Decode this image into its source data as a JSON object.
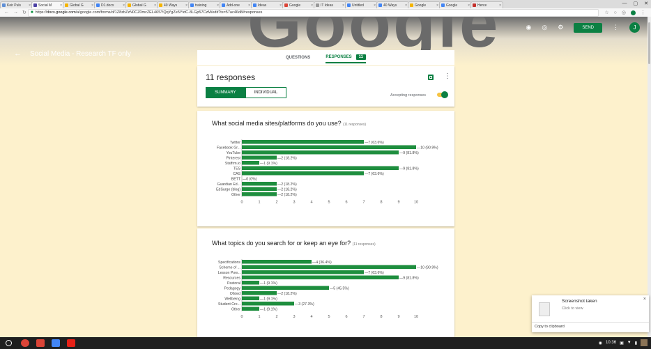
{
  "browser": {
    "tabs": [
      {
        "label": "Keir Puls",
        "color": "#5f8fd6"
      },
      {
        "label": "Social M",
        "color": "#4b3fa3",
        "active": true
      },
      {
        "label": "Global G",
        "color": "#f4b400"
      },
      {
        "label": "D1.docx",
        "color": "#4285f4"
      },
      {
        "label": "Global G",
        "color": "#f4b400"
      },
      {
        "label": "40 Ways",
        "color": "#f4b400"
      },
      {
        "label": "training",
        "color": "#4285f4"
      },
      {
        "label": "Add-one",
        "color": "#4285f4"
      },
      {
        "label": "Ideas",
        "color": "#4285f4"
      },
      {
        "label": "Google",
        "color": "#db4437"
      },
      {
        "label": "IT Ideas",
        "color": "#999999"
      },
      {
        "label": "Untitled",
        "color": "#4285f4"
      },
      {
        "label": "40 Ways",
        "color": "#4285f4"
      },
      {
        "label": "Google",
        "color": "#f4b400"
      },
      {
        "label": "Google",
        "color": "#4285f4"
      },
      {
        "label": "Herce",
        "color": "#c4302b"
      }
    ],
    "url_prefix": "https://",
    "url_host": "docs.google.com",
    "url_path": "/a/google.com/forms/d/1Z8zbZzN0CZ0mcZEL46SYQqYgZe5YtdC-8LGp57CzM/edit?ts=57ac46d8#responses"
  },
  "form": {
    "title": "Social Media - Research TF only",
    "send_label": "SEND",
    "user_initial": "J",
    "brand_color": "#0b8043",
    "tabs": {
      "questions": "QUESTIONS",
      "responses": "RESPONSES",
      "responses_count": "11"
    },
    "summary": {
      "heading": "11 responses",
      "summary_label": "SUMMARY",
      "individual_label": "INDIVIDUAL",
      "accepting_label": "Accepting responses"
    }
  },
  "questions": [
    {
      "title": "What social media sites/platforms do you use?",
      "sub": "(11 responses)"
    },
    {
      "title": "What topics do you search for or keep an eye for?",
      "sub": "(11 responses)"
    }
  ],
  "chart_data": [
    {
      "type": "bar",
      "orientation": "horizontal",
      "categories": [
        "Twitter",
        "Facebook Gr...",
        "YouTube",
        "Pinterest",
        "Staffrm.io",
        "TES",
        "CAS",
        "BETT",
        "Guardian Ed...",
        "EdSurge (blog)",
        "Other"
      ],
      "values": [
        7,
        10,
        9,
        2,
        1,
        9,
        7,
        0,
        2,
        2,
        2
      ],
      "labels": [
        "7 (63.6%)",
        "10 (90.9%)",
        "9 (81.8%)",
        "2 (18.2%)",
        "1 (9.1%)",
        "9 (81.8%)",
        "7 (63.6%)",
        "0 (0%)",
        "2 (18.2%)",
        "2 (18.2%)",
        "2 (18.2%)"
      ],
      "xlim": [
        0,
        10
      ],
      "xticks": [
        "0",
        "1",
        "2",
        "3",
        "4",
        "5",
        "6",
        "7",
        "8",
        "9",
        "10"
      ],
      "color": "#1e8e3e"
    },
    {
      "type": "bar",
      "orientation": "horizontal",
      "categories": [
        "Specifications",
        "Scheme of ...",
        "Lesson Pow...",
        "Resources",
        "Pastoral",
        "Pedagogy",
        "Ofsted",
        "Wellbeing",
        "Student Cre...",
        "Other"
      ],
      "values": [
        4,
        10,
        7,
        9,
        1,
        5,
        2,
        1,
        3,
        1
      ],
      "labels": [
        "4 (36.4%)",
        "10 (90.9%)",
        "7 (63.6%)",
        "9 (81.8%)",
        "1 (9.1%)",
        "5 (45.5%)",
        "2 (18.2%)",
        "1 (9.1%)",
        "3 (27.3%)",
        "1 (9.1%)"
      ],
      "xlim": [
        0,
        10
      ],
      "xticks": [
        "0",
        "1",
        "2",
        "3",
        "4",
        "5",
        "6",
        "7",
        "8",
        "9",
        "10"
      ],
      "color": "#1e8e3e"
    }
  ],
  "toast": {
    "title": "Screenshot taken",
    "subtitle": "Click to view",
    "action": "Copy to clipboard"
  },
  "taskbar": {
    "time": "10:36",
    "apps": [
      {
        "name": "search",
        "color": "#ffffff"
      },
      {
        "name": "chrome",
        "color": "#db4437"
      },
      {
        "name": "gmail",
        "color": "#db4437"
      },
      {
        "name": "docs",
        "color": "#4285f4"
      },
      {
        "name": "youtube",
        "color": "#e62117"
      }
    ]
  }
}
